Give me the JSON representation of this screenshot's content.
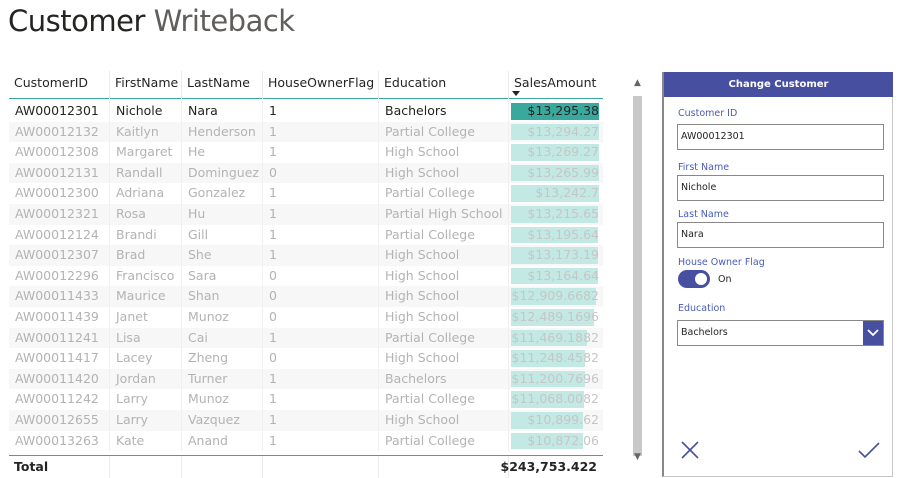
{
  "page": {
    "title_part1": "Customer",
    "title_part2": "Writeback"
  },
  "table": {
    "columns": [
      "CustomerID",
      "FirstName",
      "LastName",
      "HouseOwnerFlag",
      "Education",
      "SalesAmount"
    ],
    "rows": [
      {
        "id": "AW00012301",
        "first": "Nichole",
        "last": "Nara",
        "flag": "1",
        "edu": "Bachelors",
        "sales": "$13,295.38",
        "amount": 13295.38,
        "selected": true
      },
      {
        "id": "AW00012132",
        "first": "Kaitlyn",
        "last": "Henderson",
        "flag": "1",
        "edu": "Partial College",
        "sales": "$13,294.27",
        "amount": 13294.27
      },
      {
        "id": "AW00012308",
        "first": "Margaret",
        "last": "He",
        "flag": "1",
        "edu": "High School",
        "sales": "$13,269.27",
        "amount": 13269.27
      },
      {
        "id": "AW00012131",
        "first": "Randall",
        "last": "Dominguez",
        "flag": "0",
        "edu": "High School",
        "sales": "$13,265.99",
        "amount": 13265.99
      },
      {
        "id": "AW00012300",
        "first": "Adriana",
        "last": "Gonzalez",
        "flag": "1",
        "edu": "Partial College",
        "sales": "$13,242.7",
        "amount": 13242.7
      },
      {
        "id": "AW00012321",
        "first": "Rosa",
        "last": "Hu",
        "flag": "1",
        "edu": "Partial High School",
        "sales": "$13,215.65",
        "amount": 13215.65
      },
      {
        "id": "AW00012124",
        "first": "Brandi",
        "last": "Gill",
        "flag": "1",
        "edu": "Partial College",
        "sales": "$13,195.64",
        "amount": 13195.64
      },
      {
        "id": "AW00012307",
        "first": "Brad",
        "last": "She",
        "flag": "1",
        "edu": "High School",
        "sales": "$13,173.19",
        "amount": 13173.19
      },
      {
        "id": "AW00012296",
        "first": "Francisco",
        "last": "Sara",
        "flag": "0",
        "edu": "High School",
        "sales": "$13,164.64",
        "amount": 13164.64
      },
      {
        "id": "AW00011433",
        "first": "Maurice",
        "last": "Shan",
        "flag": "0",
        "edu": "High School",
        "sales": "$12,909.6682",
        "amount": 12909.6682
      },
      {
        "id": "AW00011439",
        "first": "Janet",
        "last": "Munoz",
        "flag": "0",
        "edu": "High School",
        "sales": "$12,489.1696",
        "amount": 12489.1696
      },
      {
        "id": "AW00011241",
        "first": "Lisa",
        "last": "Cai",
        "flag": "1",
        "edu": "Partial College",
        "sales": "$11,469.1882",
        "amount": 11469.1882
      },
      {
        "id": "AW00011417",
        "first": "Lacey",
        "last": "Zheng",
        "flag": "0",
        "edu": "High School",
        "sales": "$11,248.4582",
        "amount": 11248.4582
      },
      {
        "id": "AW00011420",
        "first": "Jordan",
        "last": "Turner",
        "flag": "1",
        "edu": "Bachelors",
        "sales": "$11,200.7696",
        "amount": 11200.7696
      },
      {
        "id": "AW00011242",
        "first": "Larry",
        "last": "Munoz",
        "flag": "1",
        "edu": "Partial College",
        "sales": "$11,068.0082",
        "amount": 11068.0082
      },
      {
        "id": "AW00012655",
        "first": "Larry",
        "last": "Vazquez",
        "flag": "1",
        "edu": "High School",
        "sales": "$10,899.62",
        "amount": 10899.62
      },
      {
        "id": "AW00013263",
        "first": "Kate",
        "last": "Anand",
        "flag": "1",
        "edu": "Partial College",
        "sales": "$10,872.06",
        "amount": 10872.06
      }
    ],
    "total_label": "Total",
    "total_value": "$243,753.422",
    "bar_max": 13295.38
  },
  "form": {
    "header": "Change Customer",
    "customer_id_label": "Customer ID",
    "customer_id_value": "AW00012301",
    "first_name_label": "First Name",
    "first_name_value": "Nichole",
    "last_name_label": "Last Name",
    "last_name_value": "Nara",
    "house_owner_label": "House Owner Flag",
    "house_owner_state": "On",
    "education_label": "Education",
    "education_value": "Bachelors"
  },
  "colors": {
    "accent": "#4750a0",
    "bar_selected": "#3aa99d",
    "bar_default": "#c3e9e4"
  },
  "icons": {
    "cancel": "close-icon",
    "submit": "checkmark-icon",
    "dropdown": "chevron-down-icon",
    "sort": "sort-descending-icon"
  }
}
